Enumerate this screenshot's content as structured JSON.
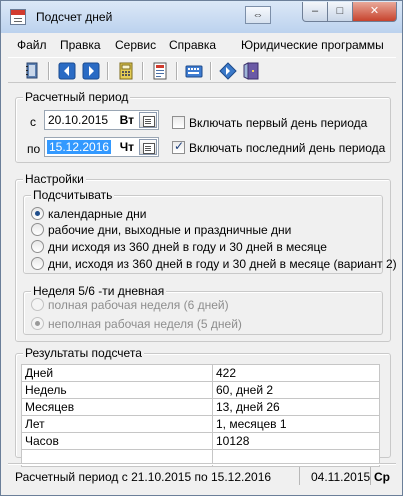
{
  "window": {
    "title": "Подсчет дней"
  },
  "menu": [
    "Файл",
    "Правка",
    "Сервис",
    "Справка",
    "Юридические программы"
  ],
  "toolbar_icons": [
    "notebook-icon",
    "back-arrow-icon",
    "forward-arrow-icon",
    "calculator-icon",
    "document-icon",
    "keyboard-icon",
    "diamond-arrow-icon",
    "exit-door-icon"
  ],
  "period": {
    "group_label": "Расчетный период",
    "from_label": "с",
    "from_value": "20.10.2015",
    "from_dow": "Вт",
    "to_label": "по",
    "to_value": "15.12.2016",
    "to_dow": "Чт",
    "include_first_label": "Включать первый день периода",
    "include_first_checked": false,
    "include_last_label": "Включать последний день периода",
    "include_last_checked": true
  },
  "settings": {
    "group_label": "Настройки",
    "count_label": "Подсчитывать",
    "count_options": [
      "календарные дни",
      "рабочие дни, выходные и праздничные дни",
      "дни исходя из 360 дней в году и 30 дней в месяце",
      "дни, исходя из 360 дней в году и 30 дней в месяце (вариант 2)"
    ],
    "count_selected": 0,
    "week_label": "Неделя 5/6 -ти дневная",
    "week_options": [
      "полная рабочая неделя (6 дней)",
      "неполная рабочая неделя (5 дней)"
    ],
    "week_selected": 1
  },
  "results": {
    "group_label": "Результаты подсчета",
    "rows": [
      {
        "name": "Дней",
        "value": "422"
      },
      {
        "name": "Недель",
        "value": "60, дней 2"
      },
      {
        "name": "Месяцев",
        "value": "13, дней 26"
      },
      {
        "name": "Лет",
        "value": "1, месяцев 1"
      },
      {
        "name": "Часов",
        "value": "10128"
      },
      {
        "name": "",
        "value": ""
      }
    ]
  },
  "status": {
    "period_text": "Расчетный период с 21.10.2015 по 15.12.2016",
    "date": "04.11.2015",
    "dow": "Ср"
  },
  "colors": {
    "accent": "#3399ff",
    "title_bar": "#c7d9f0",
    "close_button": "#c7432d"
  }
}
